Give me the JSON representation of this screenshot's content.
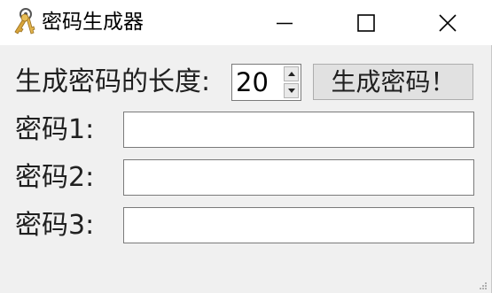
{
  "window": {
    "title": "密码生成器",
    "app_icon": "keys-icon",
    "controls": [
      "minimize-icon",
      "maximize-icon",
      "close-icon"
    ]
  },
  "form": {
    "length_label": "生成密码的长度:",
    "length_value": "20",
    "generate_button_label": "生成密码！",
    "passwords": [
      {
        "label": "密码1:",
        "value": ""
      },
      {
        "label": "密码2:",
        "value": ""
      },
      {
        "label": "密码3:",
        "value": ""
      }
    ]
  },
  "colors": {
    "titlebar_bg": "#ffffff",
    "window_bg": "#f0f0f0",
    "button_bg": "#e1e1e1",
    "key_gold": "#d8a53a"
  }
}
